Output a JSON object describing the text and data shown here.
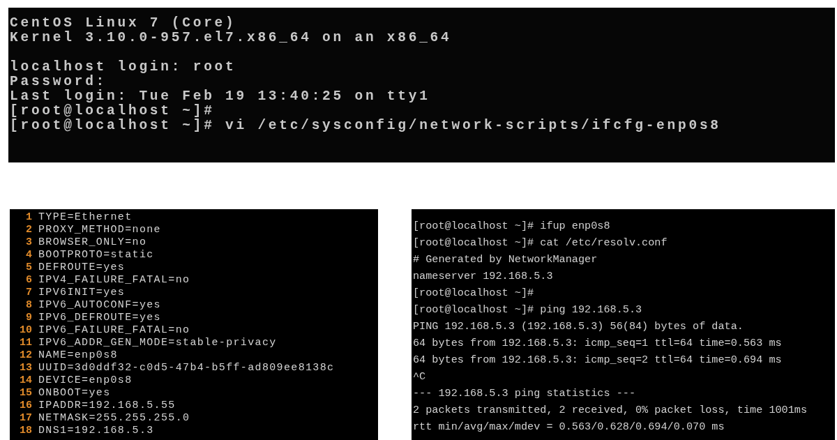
{
  "console": {
    "blocks": [
      [
        "CentOS Linux 7 (Core)",
        "Kernel 3.10.0-957.el7.x86_64 on an x86_64"
      ],
      [
        "localhost login: root",
        "Password:",
        "Last login: Tue Feb 19 13:40:25 on tty1",
        "[root@localhost ~]#",
        "[root@localhost ~]# vi /etc/sysconfig/network-scripts/ifcfg-enp0s8"
      ]
    ]
  },
  "editor": {
    "lines": [
      {
        "number": "1",
        "text": "TYPE=Ethernet"
      },
      {
        "number": "2",
        "text": "PROXY_METHOD=none"
      },
      {
        "number": "3",
        "text": "BROWSER_ONLY=no"
      },
      {
        "number": "4",
        "text": "BOOTPROTO=static"
      },
      {
        "number": "5",
        "text": "DEFROUTE=yes"
      },
      {
        "number": "6",
        "text": "IPV4_FAILURE_FATAL=no"
      },
      {
        "number": "7",
        "text": "IPV6INIT=yes"
      },
      {
        "number": "8",
        "text": "IPV6_AUTOCONF=yes"
      },
      {
        "number": "9",
        "text": "IPV6_DEFROUTE=yes"
      },
      {
        "number": "10",
        "text": "IPV6_FAILURE_FATAL=no"
      },
      {
        "number": "11",
        "text": "IPV6_ADDR_GEN_MODE=stable-privacy"
      },
      {
        "number": "12",
        "text": "NAME=enp0s8"
      },
      {
        "number": "13",
        "text": "UUID=3d0ddf32-c0d5-47b4-b5ff-ad809ee8138c"
      },
      {
        "number": "14",
        "text": "DEVICE=enp0s8"
      },
      {
        "number": "15",
        "text": "ONBOOT=yes"
      },
      {
        "number": "16",
        "text": "IPADDR=192.168.5.55"
      },
      {
        "number": "17",
        "text": "NETMASK=255.255.255.0"
      },
      {
        "number": "18",
        "text": "DNS1=192.168.5.3"
      }
    ]
  },
  "shell": {
    "lines": [
      "[root@localhost ~]# ifup enp0s8",
      "[root@localhost ~]# cat /etc/resolv.conf",
      "# Generated by NetworkManager",
      "nameserver 192.168.5.3",
      "[root@localhost ~]#",
      "[root@localhost ~]# ping 192.168.5.3",
      "PING 192.168.5.3 (192.168.5.3) 56(84) bytes of data.",
      "64 bytes from 192.168.5.3: icmp_seq=1 ttl=64 time=0.563 ms",
      "64 bytes from 192.168.5.3: icmp_seq=2 ttl=64 time=0.694 ms",
      "^C",
      "--- 192.168.5.3 ping statistics ---",
      "2 packets transmitted, 2 received, 0% packet loss, time 1001ms",
      "rtt min/avg/max/mdev = 0.563/0.628/0.694/0.070 ms"
    ]
  }
}
